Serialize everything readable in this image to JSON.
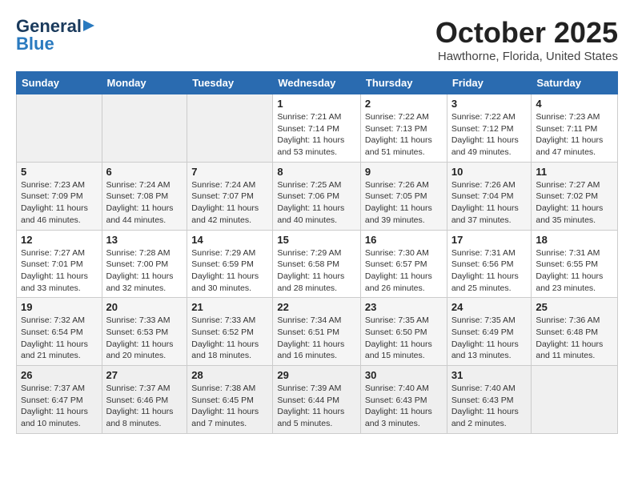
{
  "header": {
    "logo_general": "General",
    "logo_blue": "Blue",
    "month": "October 2025",
    "location": "Hawthorne, Florida, United States"
  },
  "days_of_week": [
    "Sunday",
    "Monday",
    "Tuesday",
    "Wednesday",
    "Thursday",
    "Friday",
    "Saturday"
  ],
  "weeks": [
    [
      {
        "day": "",
        "info": ""
      },
      {
        "day": "",
        "info": ""
      },
      {
        "day": "",
        "info": ""
      },
      {
        "day": "1",
        "info": "Sunrise: 7:21 AM\nSunset: 7:14 PM\nDaylight: 11 hours and 53 minutes."
      },
      {
        "day": "2",
        "info": "Sunrise: 7:22 AM\nSunset: 7:13 PM\nDaylight: 11 hours and 51 minutes."
      },
      {
        "day": "3",
        "info": "Sunrise: 7:22 AM\nSunset: 7:12 PM\nDaylight: 11 hours and 49 minutes."
      },
      {
        "day": "4",
        "info": "Sunrise: 7:23 AM\nSunset: 7:11 PM\nDaylight: 11 hours and 47 minutes."
      }
    ],
    [
      {
        "day": "5",
        "info": "Sunrise: 7:23 AM\nSunset: 7:09 PM\nDaylight: 11 hours and 46 minutes."
      },
      {
        "day": "6",
        "info": "Sunrise: 7:24 AM\nSunset: 7:08 PM\nDaylight: 11 hours and 44 minutes."
      },
      {
        "day": "7",
        "info": "Sunrise: 7:24 AM\nSunset: 7:07 PM\nDaylight: 11 hours and 42 minutes."
      },
      {
        "day": "8",
        "info": "Sunrise: 7:25 AM\nSunset: 7:06 PM\nDaylight: 11 hours and 40 minutes."
      },
      {
        "day": "9",
        "info": "Sunrise: 7:26 AM\nSunset: 7:05 PM\nDaylight: 11 hours and 39 minutes."
      },
      {
        "day": "10",
        "info": "Sunrise: 7:26 AM\nSunset: 7:04 PM\nDaylight: 11 hours and 37 minutes."
      },
      {
        "day": "11",
        "info": "Sunrise: 7:27 AM\nSunset: 7:02 PM\nDaylight: 11 hours and 35 minutes."
      }
    ],
    [
      {
        "day": "12",
        "info": "Sunrise: 7:27 AM\nSunset: 7:01 PM\nDaylight: 11 hours and 33 minutes."
      },
      {
        "day": "13",
        "info": "Sunrise: 7:28 AM\nSunset: 7:00 PM\nDaylight: 11 hours and 32 minutes."
      },
      {
        "day": "14",
        "info": "Sunrise: 7:29 AM\nSunset: 6:59 PM\nDaylight: 11 hours and 30 minutes."
      },
      {
        "day": "15",
        "info": "Sunrise: 7:29 AM\nSunset: 6:58 PM\nDaylight: 11 hours and 28 minutes."
      },
      {
        "day": "16",
        "info": "Sunrise: 7:30 AM\nSunset: 6:57 PM\nDaylight: 11 hours and 26 minutes."
      },
      {
        "day": "17",
        "info": "Sunrise: 7:31 AM\nSunset: 6:56 PM\nDaylight: 11 hours and 25 minutes."
      },
      {
        "day": "18",
        "info": "Sunrise: 7:31 AM\nSunset: 6:55 PM\nDaylight: 11 hours and 23 minutes."
      }
    ],
    [
      {
        "day": "19",
        "info": "Sunrise: 7:32 AM\nSunset: 6:54 PM\nDaylight: 11 hours and 21 minutes."
      },
      {
        "day": "20",
        "info": "Sunrise: 7:33 AM\nSunset: 6:53 PM\nDaylight: 11 hours and 20 minutes."
      },
      {
        "day": "21",
        "info": "Sunrise: 7:33 AM\nSunset: 6:52 PM\nDaylight: 11 hours and 18 minutes."
      },
      {
        "day": "22",
        "info": "Sunrise: 7:34 AM\nSunset: 6:51 PM\nDaylight: 11 hours and 16 minutes."
      },
      {
        "day": "23",
        "info": "Sunrise: 7:35 AM\nSunset: 6:50 PM\nDaylight: 11 hours and 15 minutes."
      },
      {
        "day": "24",
        "info": "Sunrise: 7:35 AM\nSunset: 6:49 PM\nDaylight: 11 hours and 13 minutes."
      },
      {
        "day": "25",
        "info": "Sunrise: 7:36 AM\nSunset: 6:48 PM\nDaylight: 11 hours and 11 minutes."
      }
    ],
    [
      {
        "day": "26",
        "info": "Sunrise: 7:37 AM\nSunset: 6:47 PM\nDaylight: 11 hours and 10 minutes."
      },
      {
        "day": "27",
        "info": "Sunrise: 7:37 AM\nSunset: 6:46 PM\nDaylight: 11 hours and 8 minutes."
      },
      {
        "day": "28",
        "info": "Sunrise: 7:38 AM\nSunset: 6:45 PM\nDaylight: 11 hours and 7 minutes."
      },
      {
        "day": "29",
        "info": "Sunrise: 7:39 AM\nSunset: 6:44 PM\nDaylight: 11 hours and 5 minutes."
      },
      {
        "day": "30",
        "info": "Sunrise: 7:40 AM\nSunset: 6:43 PM\nDaylight: 11 hours and 3 minutes."
      },
      {
        "day": "31",
        "info": "Sunrise: 7:40 AM\nSunset: 6:43 PM\nDaylight: 11 hours and 2 minutes."
      },
      {
        "day": "",
        "info": ""
      }
    ]
  ]
}
